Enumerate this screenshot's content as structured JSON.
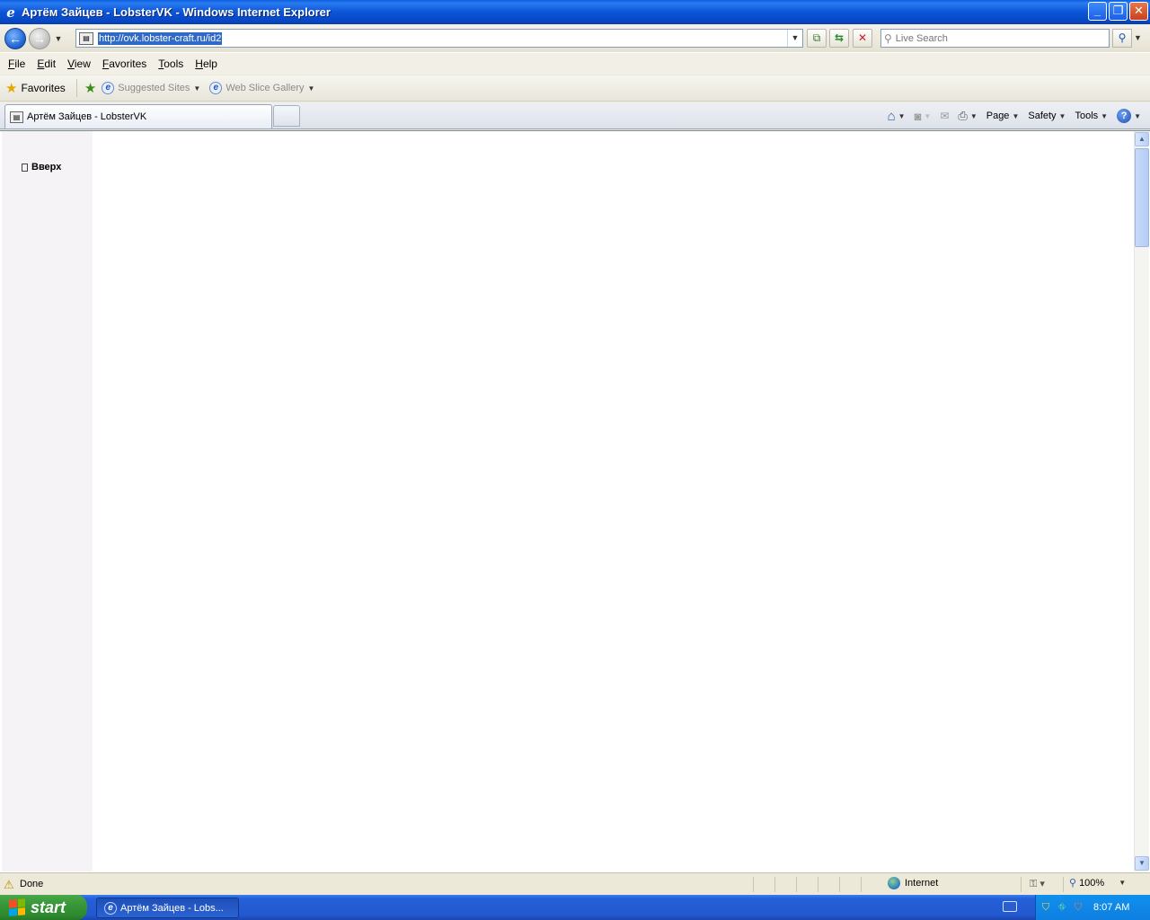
{
  "window": {
    "title": "Артём Зайцев - LobsterVK - Windows Internet Explorer",
    "app_icon": "ie-icon",
    "buttons": [
      "minimize",
      "restore",
      "close"
    ]
  },
  "address": {
    "url": "http://ovk.lobster-craft.ru/id2",
    "search_placeholder": "Live Search"
  },
  "menu": [
    "File",
    "Edit",
    "View",
    "Favorites",
    "Tools",
    "Help"
  ],
  "favorites": {
    "label": "Favorites",
    "links": [
      {
        "label": "Suggested Sites"
      },
      {
        "label": "Web Slice Gallery"
      }
    ]
  },
  "tabs": [
    {
      "label": "Артём Зайцев - LobsterVK",
      "active": true
    }
  ],
  "command_bar": {
    "page_label": "Page",
    "safety_label": "Safety",
    "tools_label": "Tools"
  },
  "page": {
    "up_link": "Вверх"
  },
  "status": {
    "text": "Done",
    "zone": "Internet",
    "zoom": "100%"
  },
  "taskbar": {
    "start_label": "start",
    "task_label": "Артём Зайцев - Lobs...",
    "clock": "8:07 AM"
  },
  "colors": {
    "titlebar": "#0b55d8",
    "taskbar": "#2358d0",
    "start": "#3b9a3b",
    "selection": "#316ac5"
  }
}
